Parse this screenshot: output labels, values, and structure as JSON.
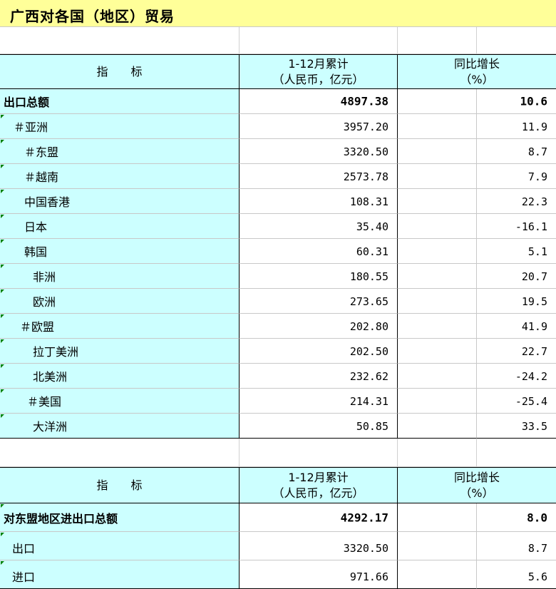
{
  "title": "广西对各国（地区）贸易",
  "headers": {
    "indicator": "指标",
    "cumulative_line1": "1-12月累计",
    "cumulative_line2": "（人民币，亿元）",
    "growth_line1": "同比增长",
    "growth_line2": "（%）"
  },
  "export_table": [
    {
      "name": "出口总额",
      "value": "4897.38",
      "growth": "10.6",
      "level": 0,
      "bold": true
    },
    {
      "name": "＃亚洲",
      "value": "3957.20",
      "growth": "11.9",
      "level": 1,
      "bold": false
    },
    {
      "name": "＃东盟",
      "value": "3320.50",
      "growth": "8.7",
      "level": 2,
      "bold": false
    },
    {
      "name": "＃越南",
      "value": "2573.78",
      "growth": "7.9",
      "level": 2,
      "bold": false
    },
    {
      "name": "中国香港",
      "value": "108.31",
      "growth": "22.3",
      "level": 3,
      "bold": false
    },
    {
      "name": "日本",
      "value": "35.40",
      "growth": "-16.1",
      "level": 3,
      "bold": false
    },
    {
      "name": "韩国",
      "value": "60.31",
      "growth": "5.1",
      "level": 3,
      "bold": false
    },
    {
      "name": "非洲",
      "value": "180.55",
      "growth": "20.7",
      "level": 4,
      "bold": false
    },
    {
      "name": "欧洲",
      "value": "273.65",
      "growth": "19.5",
      "level": 4,
      "bold": false
    },
    {
      "name": "＃欧盟",
      "value": "202.80",
      "growth": "41.9",
      "level": 5,
      "bold": false
    },
    {
      "name": "拉丁美洲",
      "value": "202.50",
      "growth": "22.7",
      "level": 4,
      "bold": false
    },
    {
      "name": "北美洲",
      "value": "232.62",
      "growth": "-24.2",
      "level": 4,
      "bold": false
    },
    {
      "name": "＃美国",
      "value": "214.31",
      "growth": "-25.4",
      "level": 6,
      "bold": false
    },
    {
      "name": "大洋洲",
      "value": "50.85",
      "growth": "33.5",
      "level": 4,
      "bold": false
    }
  ],
  "asean_table": [
    {
      "name": "对东盟地区进出口总额",
      "value": "4292.17",
      "growth": "8.0",
      "level": 0,
      "bold": true
    },
    {
      "name": "出口",
      "value": "3320.50",
      "growth": "8.7",
      "level": 7,
      "bold": false
    },
    {
      "name": "进口",
      "value": "971.66",
      "growth": "5.6",
      "level": 7,
      "bold": false
    }
  ]
}
